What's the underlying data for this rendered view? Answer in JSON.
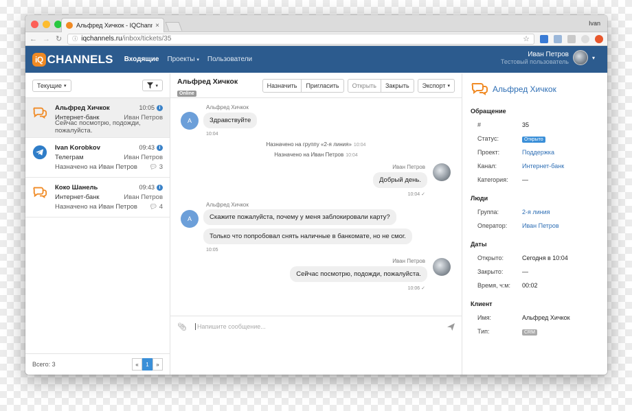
{
  "browser": {
    "tab_title": "Альфред Хичкок - IQChannels",
    "tab_close": "×",
    "profile_name": "Ivan",
    "url_host": "iqchannels.ru",
    "url_path": "/inbox/tickets/35"
  },
  "navbar": {
    "logo_badge": "iQ",
    "logo_text": "CHANNELS",
    "links": [
      "Входящие",
      "Проекты",
      "Пользователи"
    ],
    "user_name": "Иван Петров",
    "user_sub": "Тестовый пользователь"
  },
  "sidebar": {
    "filter_label": "Текущие",
    "conversations": [
      {
        "name": "Альфред Хичкок",
        "time": "10:05",
        "channel": "Интернет-банк",
        "operator": "Иван Петров",
        "last": "Сейчас посмотрю, подожди, пожалуйста.",
        "count": "",
        "icon": "chat-bubbles-icon"
      },
      {
        "name": "Ivan Korobkov",
        "time": "09:43",
        "channel": "Телеграм",
        "operator": "Иван Петров",
        "last": "Назначено на Иван Петров",
        "count": "3",
        "icon": "telegram-icon"
      },
      {
        "name": "Коко Шанель",
        "time": "09:43",
        "channel": "Интернет-банк",
        "operator": "Иван Петров",
        "last": "Назначено на Иван Петров",
        "count": "4",
        "icon": "chat-bubbles-icon"
      }
    ],
    "total": "Всего: 3",
    "pager": [
      "«",
      "1",
      "»"
    ]
  },
  "chat": {
    "title": "Альфред Хичкок",
    "status": "Online",
    "actions": [
      "Назначить",
      "Пригласить",
      "Открыть",
      "Закрыть",
      "Экспорт"
    ],
    "client_author": "Альфред Хичкок",
    "operator_author": "Иван Петров",
    "avatar_letter": "А",
    "msg1": "Здравствуйте",
    "msg1_time": "10:04",
    "sys1": "Назначено на группу «2-я линия»",
    "sys1_time": "10:04",
    "sys2": "Назначено на Иван Петров",
    "sys2_time": "10:04",
    "msg2": "Добрый день.",
    "msg2_time": "10:04",
    "msg3": "Скажите пожалуйста, почему у меня заблокировали карту?",
    "msg4": "Только что попробовал снять наличные в банкомате, но не смог.",
    "msg4_time": "10:05",
    "msg5": "Сейчас посмотрю, подожди, пожалуйста.",
    "msg5_time": "10:06",
    "compose_placeholder": "Напишите сообщение..."
  },
  "details": {
    "name": "Альфред Хичкок",
    "sections": {
      "appeal": "Обращение",
      "people": "Люди",
      "dates": "Даты",
      "client": "Клиент"
    },
    "appeal_rows": [
      {
        "k": "#",
        "v": "35"
      },
      {
        "k": "Статус:",
        "v": "Открыто"
      },
      {
        "k": "Проект:",
        "v": "Поддержка"
      },
      {
        "k": "Канал:",
        "v": "Интернет-банк"
      },
      {
        "k": "Категория:",
        "v": "—"
      }
    ],
    "people_rows": [
      {
        "k": "Группа:",
        "v": "2-я линия"
      },
      {
        "k": "Оператор:",
        "v": "Иван Петров"
      }
    ],
    "date_rows": [
      {
        "k": "Открыто:",
        "v": "Сегодня в 10:04"
      },
      {
        "k": "Закрыто:",
        "v": "—"
      },
      {
        "k": "Время, ч:м:",
        "v": "00:02"
      }
    ],
    "client_rows": [
      {
        "k": "Имя:",
        "v": "Альфред Хичкок"
      },
      {
        "k": "Тип:",
        "v": "CRM"
      }
    ]
  },
  "colors": {
    "navbar": "#2c5b8e",
    "accent": "#f08a24",
    "link": "#2f6fb5",
    "status_open": "#3a8fd8",
    "crm": "#aaaaaa"
  }
}
